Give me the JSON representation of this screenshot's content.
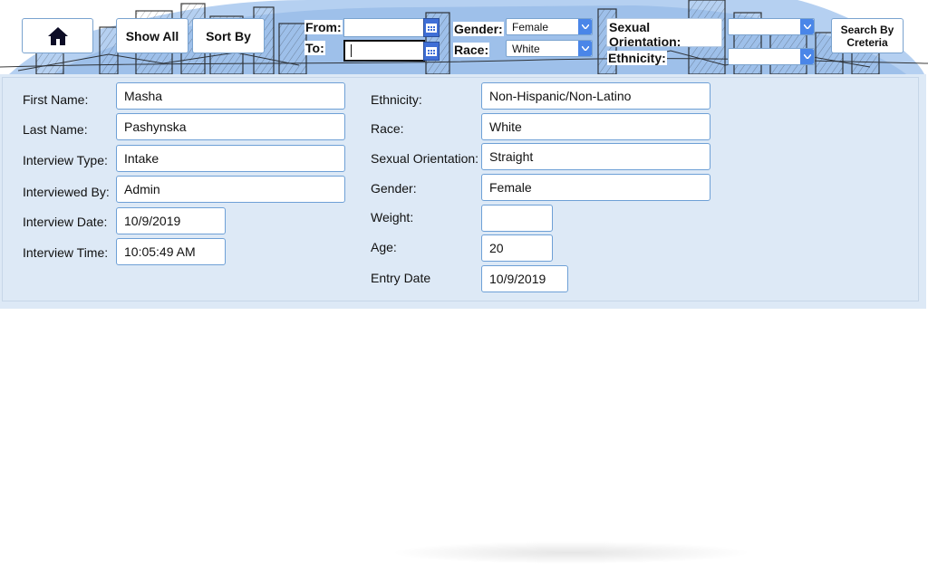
{
  "toolbar": {
    "home_icon": "home-icon",
    "show_all": "Show All",
    "sort_by": "Sort By",
    "from_label": "From:",
    "from_value": "",
    "to_label": "To:",
    "to_value": "",
    "calendar_icon": "calendar-icon",
    "gender_label": "Gender:",
    "gender_value": "Female",
    "race_label": "Race:",
    "race_value": "White",
    "sexual_orientation_label": "Sexual Orientation:",
    "sexual_orientation_value": "",
    "ethnicity_label": "Ethnicity:",
    "ethnicity_value": "",
    "search_button": "Search By Creteria",
    "dropdown_icon": "chevron-down-icon"
  },
  "details": {
    "first_name_label": "First Name:",
    "first_name": "Masha",
    "last_name_label": "Last Name:",
    "last_name": "Pashynska",
    "interview_type_label": "Interview Type:",
    "interview_type": "Intake",
    "interviewed_by_label": "Interviewed By:",
    "interviewed_by": "Admin",
    "interview_date_label": "Interview Date:",
    "interview_date": "10/9/2019",
    "interview_time_label": "Interview Time:",
    "interview_time": "10:05:49 AM",
    "ethnicity_label": "Ethnicity:",
    "ethnicity": "Non-Hispanic/Non-Latino",
    "race_label": "Race:",
    "race": "White",
    "sexual_orientation_label": "Sexual Orientation:",
    "sexual_orientation": "Straight",
    "gender_label": "Gender:",
    "gender": "Female",
    "weight_label": "Weight:",
    "weight": "",
    "age_label": "Age:",
    "age": "20",
    "entry_date_label": "Entry Date",
    "entry_date": "10/9/2019"
  },
  "colors": {
    "panel_bg": "#dde9f6",
    "field_border": "#6ea0d6",
    "accent_blue": "#4a86e8",
    "sketch_blue": "#9fc1ea"
  }
}
